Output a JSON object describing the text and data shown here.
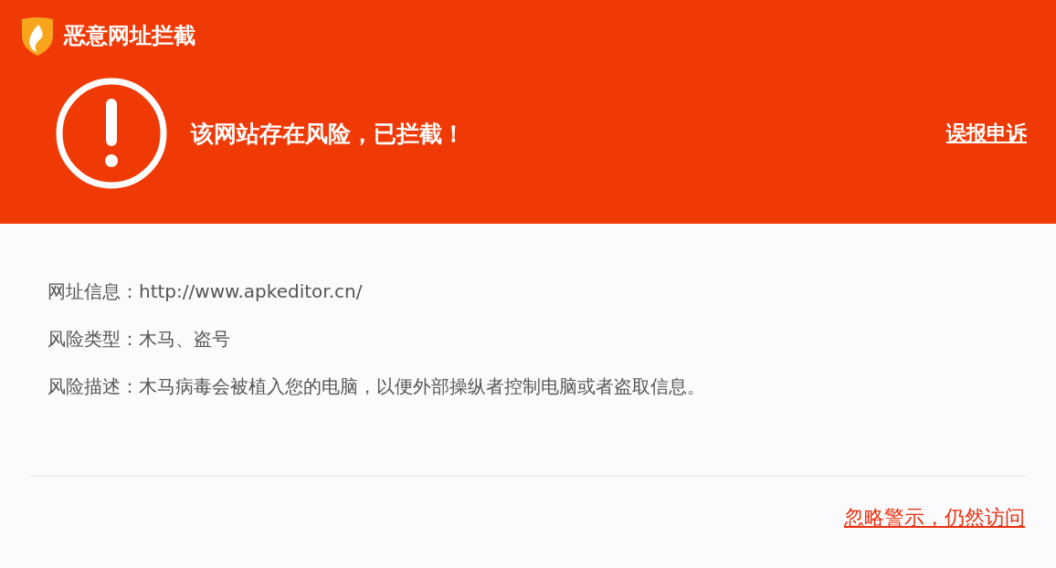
{
  "header": {
    "title": "恶意网址拦截",
    "message": "该网站存在风险，已拦截！",
    "appeal_link": "误报申诉"
  },
  "details": [
    {
      "label": "网址信息：",
      "value": "http://www.apkeditor.cn/"
    },
    {
      "label": "风险类型：",
      "value": "木马、盗号"
    },
    {
      "label": "风险描述：",
      "value": "木马病毒会被植入您的电脑，以便外部操纵者控制电脑或者盗取信息。"
    }
  ],
  "footer": {
    "ignore_link": "忽略警示，仍然访问"
  }
}
